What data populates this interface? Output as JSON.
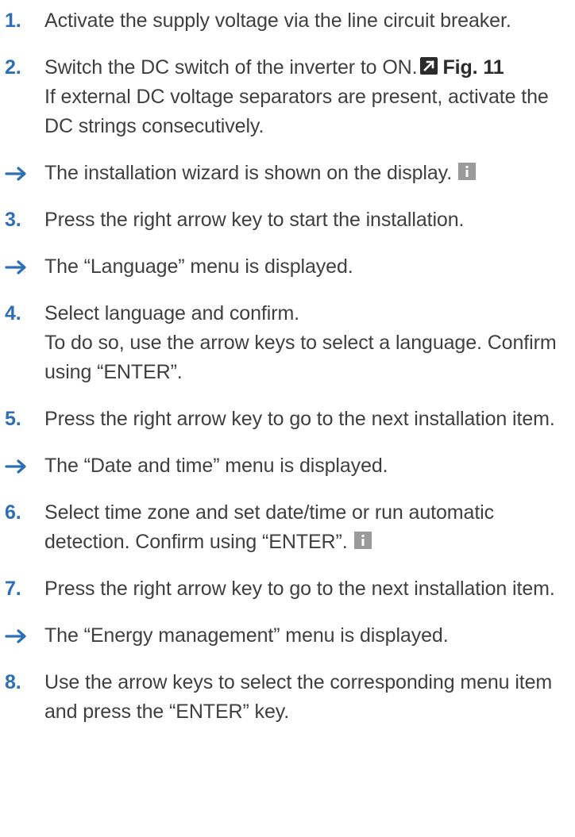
{
  "steps": [
    {
      "num": "1.",
      "text": "Activate the supply voltage via the line circuit breaker."
    },
    {
      "num": "2.",
      "text": "Switch the DC switch of the inverter to ON.",
      "ref": "Fig. 11",
      "note": "If external DC voltage separators are present, activate the DC strings consecutively."
    },
    {
      "num": "3.",
      "text": "Press the right arrow key to start the installation."
    },
    {
      "num": "4.",
      "text": "Select language and confirm.",
      "note": "To do so, use the arrow keys to select a language. Confirm using “ENTER”."
    },
    {
      "num": "5.",
      "text": "Press the right arrow key to go to the next installation item."
    },
    {
      "num": "6.",
      "text": "Select time zone and set date/time or run automatic detection. Confirm using “ENTER”."
    },
    {
      "num": "7.",
      "text": "Press the right arrow key to go to the next installation item."
    },
    {
      "num": "8.",
      "text": "Use the arrow keys to select the corresponding menu item and press the “ENTER” key."
    }
  ],
  "results": [
    {
      "text": "The installation wizard is shown on the display."
    },
    {
      "text": "The “Language” menu is displayed."
    },
    {
      "text": "The “Date and time” menu is displayed."
    },
    {
      "text": "The “Energy management” menu is displayed."
    }
  ],
  "icons": {
    "arrow": "result-arrow-icon",
    "ref": "cross-reference-icon",
    "info": "info-icon"
  },
  "colors": {
    "step_number": "#2d6fb6",
    "text": "#3f3f3f",
    "info_icon": "#9a9a9a"
  }
}
